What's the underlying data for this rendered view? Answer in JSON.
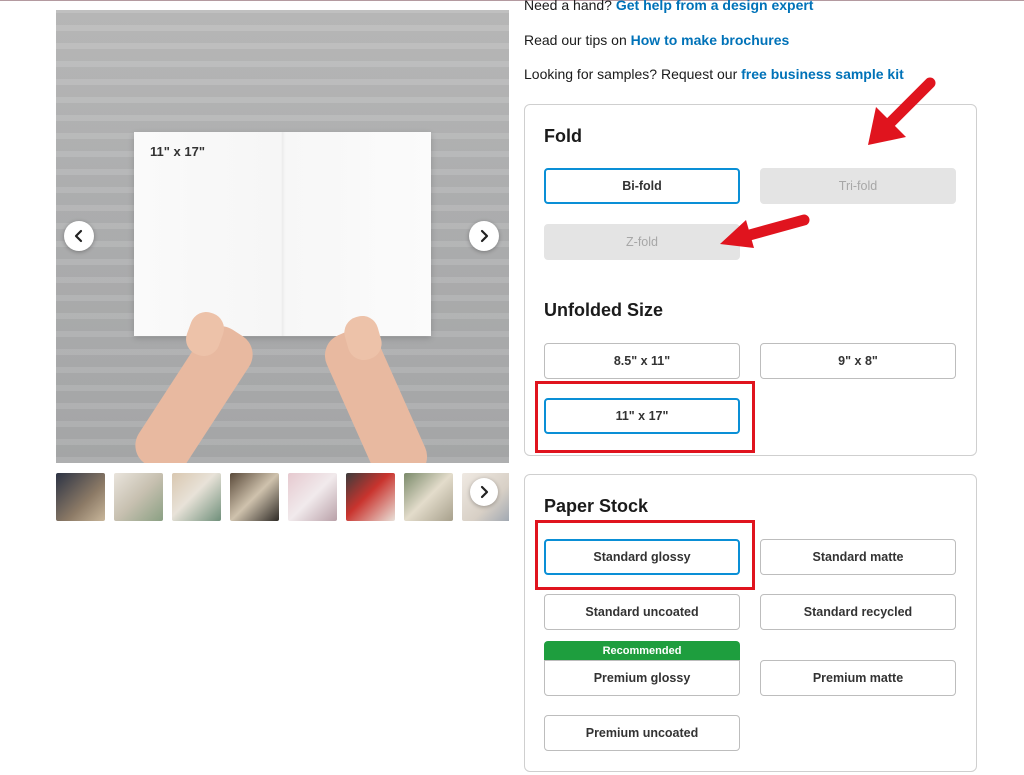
{
  "help": {
    "line1_prefix": "Need a hand? ",
    "line1_link": "Get help from a design expert",
    "line2_prefix": "Read our tips on ",
    "line2_link": "How to make brochures",
    "line3_prefix": "Looking for samples? Request our ",
    "line3_link": "free business sample kit"
  },
  "gallery": {
    "image_label": "11\" x 17\"",
    "prev_icon": "chevron-left-icon",
    "next_icon": "chevron-right-icon"
  },
  "fold": {
    "title": "Fold",
    "options": [
      {
        "label": "Bi-fold",
        "state": "selected"
      },
      {
        "label": "Tri-fold",
        "state": "disabled"
      },
      {
        "label": "Z-fold",
        "state": "disabled"
      }
    ]
  },
  "size": {
    "title": "Unfolded Size",
    "options": [
      {
        "label": "8.5\" x 11\"",
        "state": "default"
      },
      {
        "label": "9\" x 8\"",
        "state": "default"
      },
      {
        "label": "11\" x 17\"",
        "state": "selected"
      }
    ]
  },
  "stock": {
    "title": "Paper Stock",
    "recommended_badge": "Recommended",
    "options": [
      {
        "label": "Standard glossy",
        "state": "selected"
      },
      {
        "label": "Standard matte",
        "state": "default"
      },
      {
        "label": "Standard uncoated",
        "state": "default"
      },
      {
        "label": "Standard recycled",
        "state": "default"
      },
      {
        "label": "Premium glossy",
        "state": "default"
      },
      {
        "label": "Premium matte",
        "state": "default"
      },
      {
        "label": "Premium uncoated",
        "state": "default"
      }
    ]
  },
  "colors": {
    "link": "#0072b8",
    "selected_border": "#0a8fd6",
    "annotation_red": "#e0141e",
    "recommended_green": "#1e9e3e"
  }
}
